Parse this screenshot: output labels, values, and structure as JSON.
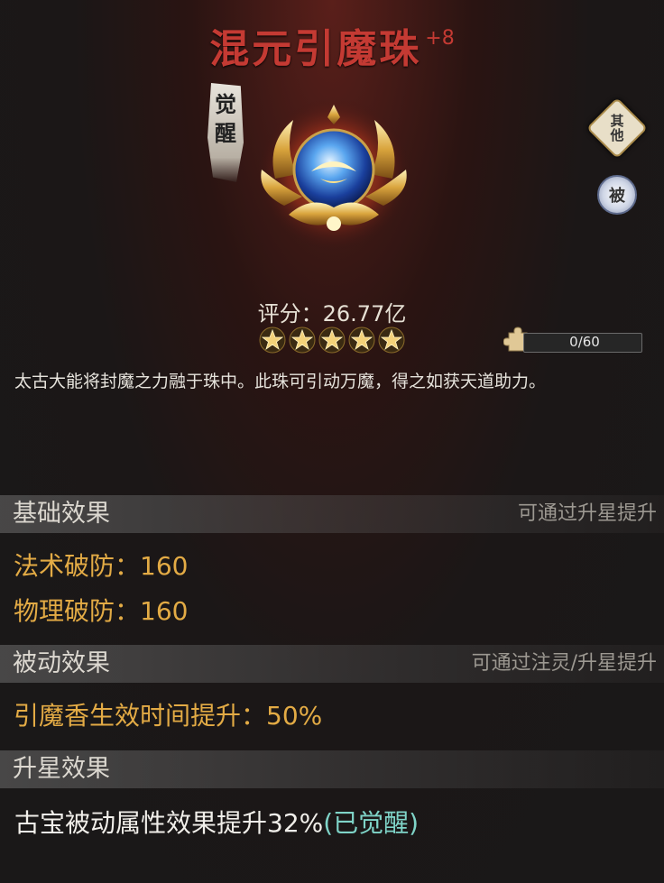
{
  "item": {
    "name": "混元引魔珠",
    "level": "+8",
    "awaken_tag": [
      "觉",
      "醒"
    ],
    "score_label": "评分：26.77亿",
    "stars": 5,
    "fragments": "0/60",
    "description": "太古大能将封魔之力融于珠中。此珠可引动万魔，得之如获天道助力。"
  },
  "side_buttons": {
    "other": [
      "其",
      "他"
    ],
    "passive": "被"
  },
  "sections": {
    "basic": {
      "title": "基础效果",
      "note": "可通过升星提升",
      "stats": [
        "法术破防：160",
        "物理破防：160"
      ]
    },
    "passive": {
      "title": "被动效果",
      "note": "可通过注灵/升星提升",
      "stats": [
        "引魔香生效时间提升：50%"
      ]
    },
    "star": {
      "title": "升星效果",
      "effect": "古宝被动属性效果提升32%",
      "status": "(已觉醒)"
    }
  },
  "colors": {
    "title": "#c43a33",
    "stat": "#e3ab45",
    "awakened": "#7fd4c8"
  }
}
